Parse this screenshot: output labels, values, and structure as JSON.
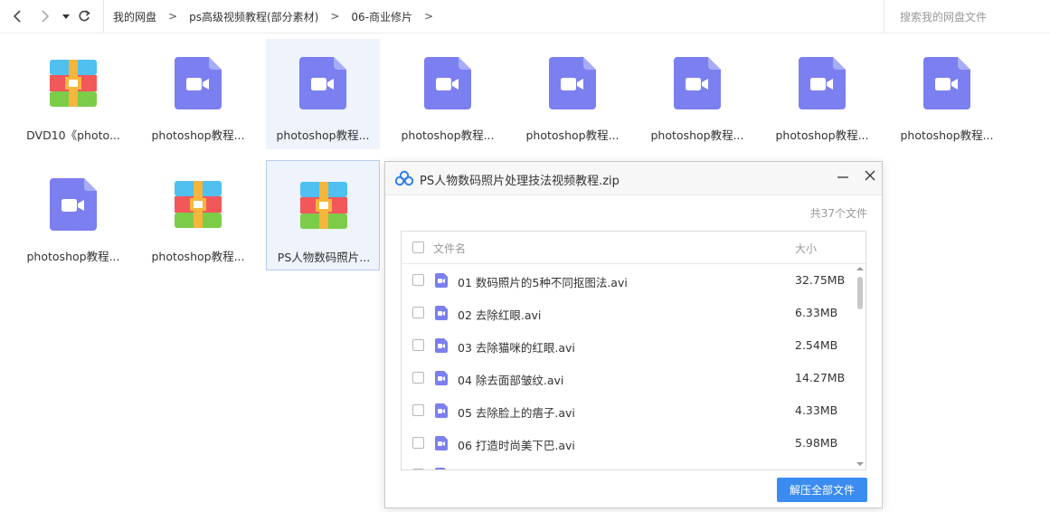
{
  "breadcrumb": [
    "我的网盘",
    "ps高级视频教程(部分素材)",
    "06-商业修片"
  ],
  "search": {
    "placeholder": "搜索我的网盘文件"
  },
  "tiles": [
    {
      "name": "DVD10《photo...",
      "type": "archive"
    },
    {
      "name": "photoshop教程...",
      "type": "video"
    },
    {
      "name": "photoshop教程...",
      "type": "video"
    },
    {
      "name": "photoshop教程...",
      "type": "video"
    },
    {
      "name": "photoshop教程...",
      "type": "video"
    },
    {
      "name": "photoshop教程...",
      "type": "video"
    },
    {
      "name": "photoshop教程...",
      "type": "video"
    },
    {
      "name": "photoshop教程...",
      "type": "video"
    },
    {
      "name": "photoshop教程...",
      "type": "video"
    },
    {
      "name": "photoshop教程...",
      "type": "archive"
    },
    {
      "name": "PS人物数码照片...",
      "type": "archive"
    }
  ],
  "dialog": {
    "title": "PS人物数码照片处理技法视频教程.zip",
    "count_label": "共37个文件",
    "col_name": "文件名",
    "col_size": "大小",
    "files": [
      {
        "name": "01 数码照片的5种不同抠图法.avi",
        "size": "32.75MB"
      },
      {
        "name": "02 去除红眼.avi",
        "size": "6.33MB"
      },
      {
        "name": "03 去除猫咪的红眼.avi",
        "size": "2.54MB"
      },
      {
        "name": "04 除去面部皱纹.avi",
        "size": "14.27MB"
      },
      {
        "name": "05 去除脸上的痦子.avi",
        "size": "4.33MB"
      },
      {
        "name": "06 打造时尚美下巴.avi",
        "size": "5.98MB"
      }
    ],
    "extract_label": "解压全部文件"
  },
  "colors": {
    "accent": "#3b8cf0",
    "video_icon": "#7b7ff0"
  }
}
